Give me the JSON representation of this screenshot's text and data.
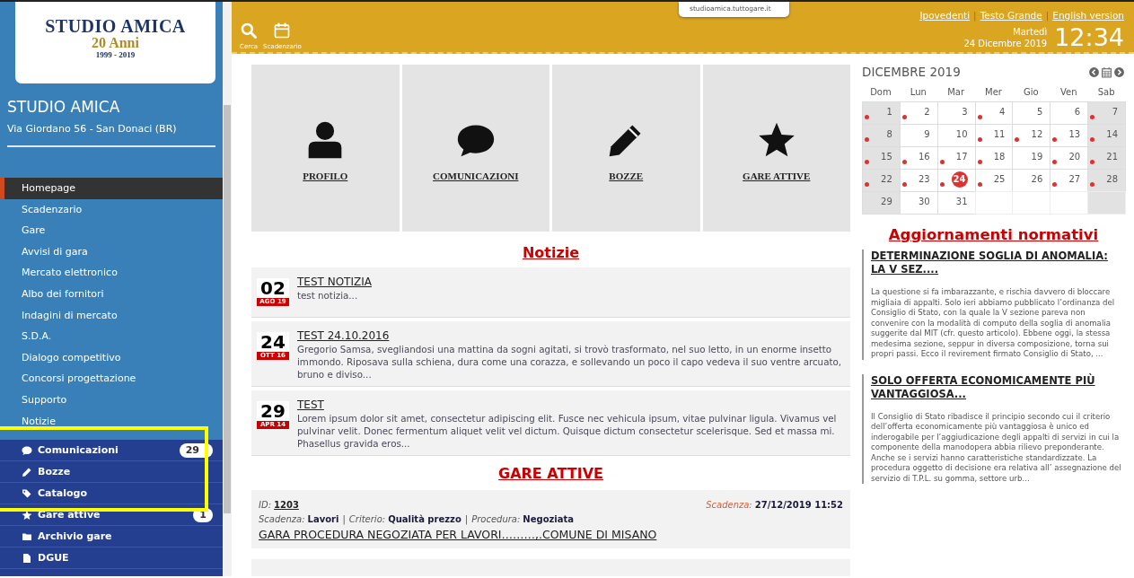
{
  "sidebar": {
    "logo": {
      "name": "STUDIO AMICA",
      "anniversary": "20 Anni",
      "years": "1999 - 2019"
    },
    "title": "STUDIO AMICA",
    "address": "Via Giordano 56 - San Donaci (BR)",
    "menu": [
      {
        "label": "Homepage",
        "selected": true
      },
      {
        "label": "Scadenzario",
        "selected": false
      },
      {
        "label": "Gare",
        "selected": false
      },
      {
        "label": "Avvisi di gara",
        "selected": false
      },
      {
        "label": "Mercato elettronico",
        "selected": false
      },
      {
        "label": "Albo dei fornitori",
        "selected": false
      },
      {
        "label": "Indagini di mercato",
        "selected": false
      },
      {
        "label": "S.D.A.",
        "selected": false
      },
      {
        "label": "Dialogo competitivo",
        "selected": false
      },
      {
        "label": "Concorsi progettazione",
        "selected": false
      },
      {
        "label": "Supporto",
        "selected": false
      },
      {
        "label": "Notizie",
        "selected": false
      }
    ],
    "user_menu": [
      {
        "kind": "comment",
        "label": "Comunicazioni",
        "badge": "29"
      },
      {
        "kind": "pencil",
        "label": "Bozze"
      },
      {
        "kind": "tag",
        "label": "Catalogo"
      },
      {
        "kind": "star",
        "label": "Gare attive",
        "badge": "1"
      },
      {
        "kind": "folder",
        "label": "Archivio gare"
      },
      {
        "kind": "file",
        "label": "DGUE"
      }
    ]
  },
  "header": {
    "tools": [
      {
        "kind": "search",
        "label": "Cerca"
      },
      {
        "kind": "calendar",
        "label": "Scadenzario"
      }
    ],
    "url_tooltip": "studioamica.tuttogare.it",
    "links": [
      "Ipovedenti",
      "Testo Grande",
      "English version"
    ],
    "link_separator": "|",
    "weekday": "Martedì",
    "date": "24 Dicembre 2019",
    "time": "12:34"
  },
  "tiles": [
    {
      "kind": "user",
      "label": "PROFILO"
    },
    {
      "kind": "comment",
      "label": "COMUNICAZIONI"
    },
    {
      "kind": "pencil",
      "label": "BOZZE"
    },
    {
      "kind": "star",
      "label": "GARE ATTIVE"
    }
  ],
  "news": {
    "title": "Notizie",
    "items": [
      {
        "day": "02",
        "month": "AGO 19",
        "title": "TEST NOTIZIA",
        "text": "test notizia..."
      },
      {
        "day": "24",
        "month": "OTT 16",
        "title": "TEST 24.10.2016",
        "text": "Gregorio Samsa, svegliandosi una mattina da sogni agitati, si trovò trasformato, nel suo letto, in un enorme insetto immondo. Riposava sulla schiena, dura come una corazza, e sollevando un poco il capo vedeva il suo ventre arcuato, bruno e diviso..."
      },
      {
        "day": "29",
        "month": "APR 14",
        "title": "TEST",
        "text": "Lorem ipsum dolor sit amet, consectetur adipiscing elit. Fusce nec vehicula ipsum, vitae pulvinar ligula. Vivamus vel pulvinar velit. Donec fermentum aliquet velit vel dictum. Quisque dictum consectetur scelerisque. Sed et massa mi. Phasellus gravida eros..."
      }
    ]
  },
  "tenders": {
    "title": "GARE ATTIVE",
    "separator": "|",
    "items": [
      {
        "id_label": "ID:",
        "id": "1203",
        "deadline_label": "Scadenza:",
        "deadline": "27/12/2019 11:52",
        "fields": [
          {
            "label": "Scadenza:",
            "value": "Lavori"
          },
          {
            "label": "Criterio:",
            "value": "Qualità prezzo"
          },
          {
            "label": "Procedura:",
            "value": "Negoziata"
          }
        ],
        "title": "GARA PROCEDURA NEGOZIATA PER LAVORI………,.COMUNE DI MISANO"
      }
    ]
  },
  "calendar": {
    "title": "DICEMBRE 2019",
    "weekdays": [
      "Dom",
      "Lun",
      "Mar",
      "Mer",
      "Gio",
      "Ven",
      "Sab"
    ],
    "days": [
      {
        "day": "1",
        "event": true,
        "today": false
      },
      {
        "day": "2",
        "event": true,
        "today": false
      },
      {
        "day": "3",
        "event": false,
        "today": false
      },
      {
        "day": "4",
        "event": true,
        "today": false
      },
      {
        "day": "5",
        "event": false,
        "today": false
      },
      {
        "day": "6",
        "event": false,
        "today": false
      },
      {
        "day": "7",
        "event": true,
        "today": false
      },
      {
        "day": "8",
        "event": true,
        "today": false
      },
      {
        "day": "9",
        "event": false,
        "today": false
      },
      {
        "day": "10",
        "event": false,
        "today": false
      },
      {
        "day": "11",
        "event": true,
        "today": false
      },
      {
        "day": "12",
        "event": true,
        "today": false
      },
      {
        "day": "13",
        "event": true,
        "today": false
      },
      {
        "day": "14",
        "event": true,
        "today": false
      },
      {
        "day": "15",
        "event": true,
        "today": false
      },
      {
        "day": "16",
        "event": true,
        "today": false
      },
      {
        "day": "17",
        "event": true,
        "today": false
      },
      {
        "day": "18",
        "event": true,
        "today": false
      },
      {
        "day": "19",
        "event": false,
        "today": false
      },
      {
        "day": "20",
        "event": true,
        "today": false
      },
      {
        "day": "21",
        "event": true,
        "today": false
      },
      {
        "day": "22",
        "event": true,
        "today": false
      },
      {
        "day": "23",
        "event": true,
        "today": false
      },
      {
        "day": "24",
        "event": true,
        "today": true
      },
      {
        "day": "25",
        "event": true,
        "today": false
      },
      {
        "day": "26",
        "event": false,
        "today": false
      },
      {
        "day": "27",
        "event": true,
        "today": false
      },
      {
        "day": "28",
        "event": true,
        "today": false
      },
      {
        "day": "29",
        "event": false,
        "today": false
      },
      {
        "day": "30",
        "event": false,
        "today": false
      },
      {
        "day": "31",
        "event": false,
        "today": false
      }
    ]
  },
  "updates": {
    "title": "Aggiornamenti normativi",
    "items": [
      {
        "title": "DETERMINAZIONE SOGLIA DI ANOMALIA: LA V SEZ....",
        "text": "La questione si fa imbarazzante, e rischia davvero di bloccare migliaia di appalti. Solo ieri abbiamo pubblicato l’ordinanza del Consiglio di Stato, con la quale la V sezione pareva non convenire con la modalità di computo della soglia di anomalia suggerite dal MIT (cfr. questo articolo). Ebbene oggi, la stessa medesima sezione, seppur in diversa composizione, torna sui propri passi. Ecco il revirement firmato Consiglio di Stato, ..."
      },
      {
        "title": "SOLO OFFERTA ECONOMICAMENTE PIÙ VANTAGGIOSA...",
        "text": "Il Consiglio di Stato ribadisce il principio secondo cui il criterio dell’offerta economicamente più vantaggiosa è unico ed inderogabile per l’aggiudicazione degli appalti di servizi in cui la componente della manodopera abbia rilievo preponderante. Anche se i servizi hanno caratteristiche standardizzate. La procedura oggetto di decisione era relativa all’ assegnazione del servizio di T.P.L. su gomma, settore urb..."
      }
    ]
  }
}
